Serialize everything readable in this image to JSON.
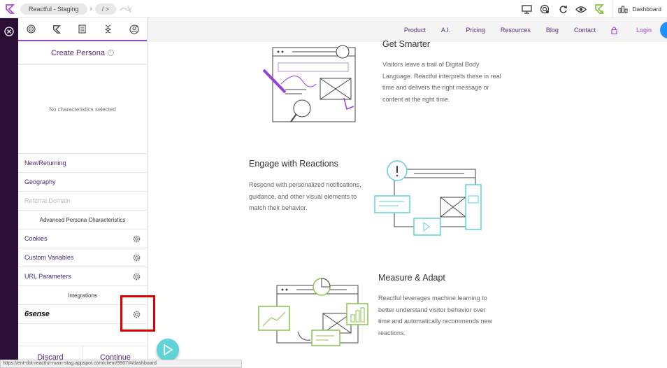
{
  "topbar": {
    "env_label": "Reactful - Staging",
    "path_label": "/ >",
    "dashboard_label": "Dashboard"
  },
  "panel": {
    "tabs": [
      "target",
      "flag",
      "document",
      "dna",
      "user-add"
    ],
    "title": "Create Persona",
    "empty_text": "No characteristics selected",
    "rows": {
      "new_returning": "New/Returning",
      "geography": "Geography",
      "referral": "Referral Domain",
      "advanced": "Advanced Persona Characteristics",
      "cookies": "Cookies",
      "custom_vars": "Custom Variables",
      "url_params": "URL Parameters",
      "integrations": "Integrations",
      "sense": "6sense"
    },
    "discard": "Discard",
    "continue": "Continue"
  },
  "status_url": "https://ent-dot-reactful-main-stag.appspot.com/client/9907/#/dashboard",
  "site_nav": {
    "items": [
      "Product",
      "A.I.",
      "Pricing",
      "Resources",
      "Blog",
      "Contact"
    ],
    "login": "Login"
  },
  "features": [
    {
      "title": "Get Smarter",
      "text": "Visitors leave a trail of Digital Body Language. Reactful interprets these in real time and delivers the right message or content at the right time."
    },
    {
      "title": "Engage with Reactions",
      "text": "Respond with personalized notifications, guidance, and other visual elements to match their behavior."
    },
    {
      "title": "Measure & Adapt",
      "text": "Reactful leverages machine learning to better understand visitor behavior over time and automatically recommends new reactions."
    }
  ],
  "colors": {
    "accent": "#9b3fd9",
    "rail": "#2b0d36",
    "teal": "#5fd3d8",
    "green": "#8bc34a"
  }
}
